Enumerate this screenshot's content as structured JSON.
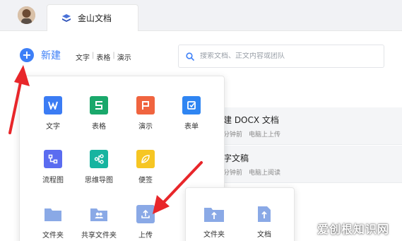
{
  "tab": {
    "title": "金山文档"
  },
  "toolbar": {
    "new_label": "新建",
    "quick_links": [
      "文字",
      "表格",
      "演示"
    ]
  },
  "search": {
    "placeholder": "搜索文档、正文内容或团队"
  },
  "files": [
    {
      "name": "建 DOCX 文档",
      "time": "分钟前",
      "action": "电脑上上传"
    },
    {
      "name": "字文稿",
      "time": "分钟前",
      "action": "电脑上阅读"
    }
  ],
  "new_menu": {
    "items": [
      {
        "label": "文字",
        "icon": "w-icon",
        "color": "#3b7cf4"
      },
      {
        "label": "表格",
        "icon": "s-icon",
        "color": "#1aa86b"
      },
      {
        "label": "演示",
        "icon": "p-icon",
        "color": "#f0643f"
      },
      {
        "label": "表单",
        "icon": "form-icon",
        "color": "#2f85f2"
      },
      {
        "label": "流程图",
        "icon": "flowchart-icon",
        "color": "#5a6cf0"
      },
      {
        "label": "思维导图",
        "icon": "mindmap-icon",
        "color": "#16b4a0"
      },
      {
        "label": "便签",
        "icon": "leaf-icon",
        "color": "#f6c623"
      },
      {
        "label": "文件夹",
        "icon": "folder-icon",
        "color": "#8aa9e6"
      },
      {
        "label": "共享文件夹",
        "icon": "shared-folder-icon",
        "color": "#8aa9e6"
      },
      {
        "label": "上传",
        "icon": "upload-icon",
        "color": "#8aa9e6"
      }
    ]
  },
  "upload_menu": {
    "items": [
      {
        "label": "文件夹",
        "icon": "folder-upload-icon"
      },
      {
        "label": "文档",
        "icon": "file-upload-icon"
      }
    ]
  },
  "watermark": "爱创根知识网",
  "colors": {
    "accent": "#3d7ff7",
    "arrow": "#e8262a"
  }
}
